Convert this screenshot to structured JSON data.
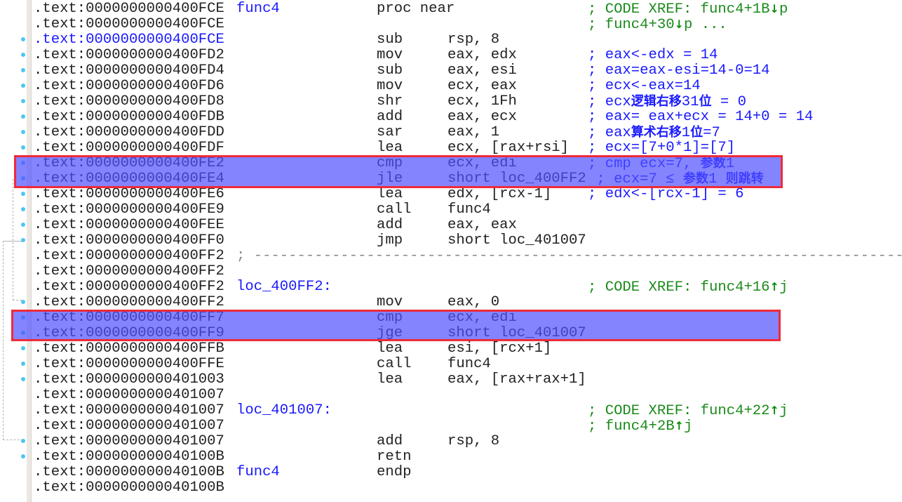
{
  "view": "IDA View",
  "colors": {
    "highlight": "#8080ff",
    "highlight_border": "#ee2b3a",
    "comment": "#1a1aff",
    "xref": "#1a8a1a",
    "label": "#1a1aff"
  },
  "lines": [
    {
      "addr": ".text:0000000000400FCE",
      "label": "func4",
      "mn": "proc near",
      "op": "",
      "cm": [
        {
          "t": "; CODE XREF: func4+1B"
        },
        {
          "t": "↓",
          "a": 1
        },
        {
          "t": "p"
        }
      ],
      "xref": true,
      "dot": false
    },
    {
      "addr": ".text:0000000000400FCE",
      "label": "",
      "mn": "",
      "op": "",
      "cm": [
        {
          "t": "; func4+30"
        },
        {
          "t": "↓",
          "a": 1
        },
        {
          "t": "p ..."
        }
      ],
      "xref": true,
      "dot": false
    },
    {
      "addr": ".text:0000000000400FCE",
      "cur": true,
      "label": "",
      "mn": "sub",
      "op": "rsp, 8",
      "cm": [],
      "dot": true
    },
    {
      "addr": ".text:0000000000400FD2",
      "label": "",
      "mn": "mov",
      "op": "eax, edx",
      "cm": [
        {
          "t": "; eax<-edx = 14"
        }
      ],
      "dot": true
    },
    {
      "addr": ".text:0000000000400FD4",
      "label": "",
      "mn": "sub",
      "op": "eax, esi",
      "cm": [
        {
          "t": "; eax=eax-esi=14-0=14"
        }
      ],
      "dot": true
    },
    {
      "addr": ".text:0000000000400FD6",
      "label": "",
      "mn": "mov",
      "op": "ecx, eax",
      "cm": [
        {
          "t": "; ecx<-eax=14"
        }
      ],
      "dot": true
    },
    {
      "addr": ".text:0000000000400FD8",
      "label": "",
      "mn": "shr",
      "op": "ecx, 1Fh",
      "cm": [
        {
          "t": "; ecx"
        },
        {
          "t": "逻辑右移",
          "b": 1
        },
        {
          "t": "31"
        },
        {
          "t": "位",
          "b": 1
        },
        {
          "t": " = 0"
        }
      ],
      "dot": true
    },
    {
      "addr": ".text:0000000000400FDB",
      "label": "",
      "mn": "add",
      "op": "eax, ecx",
      "cm": [
        {
          "t": "; eax= eax+ecx = 14+0 = 14"
        }
      ],
      "dot": true
    },
    {
      "addr": ".text:0000000000400FDD",
      "label": "",
      "mn": "sar",
      "op": "eax, 1",
      "cm": [
        {
          "t": "; eax"
        },
        {
          "t": "算术右移",
          "b": 1
        },
        {
          "t": "1"
        },
        {
          "t": "位",
          "b": 1
        },
        {
          "t": "=7"
        }
      ],
      "dot": true
    },
    {
      "addr": ".text:0000000000400FDF",
      "label": "",
      "mn": "lea",
      "op": "ecx, [rax+rsi]",
      "cm": [
        {
          "t": "; ecx=[7+0*1]=[7]"
        }
      ],
      "dot": true
    },
    {
      "addr": ".text:0000000000400FE2",
      "label": "",
      "mn": "cmp",
      "op": "ecx, edi",
      "cm": [
        {
          "t": "; cmp ecx=7, "
        },
        {
          "t": "参数",
          "b": 1
        },
        {
          "t": "1"
        }
      ],
      "dot": true
    },
    {
      "addr": ".text:0000000000400FE4",
      "label": "",
      "mn": "jle",
      "op": "short loc_400FF2",
      "cm": [
        {
          "t": " ; ecx=7 ≤ "
        },
        {
          "t": "参数",
          "b": 1
        },
        {
          "t": "1 "
        },
        {
          "t": "则跳转",
          "b": 1
        }
      ],
      "dot": true
    },
    {
      "addr": ".text:0000000000400FE6",
      "label": "",
      "mn": "lea",
      "op": "edx, [rcx-1]",
      "cm": [
        {
          "t": "; edx<-[rcx-1] = 6"
        }
      ],
      "dot": true
    },
    {
      "addr": ".text:0000000000400FE9",
      "label": "",
      "mn": "call",
      "op": "func4",
      "cm": [],
      "dot": true
    },
    {
      "addr": ".text:0000000000400FEE",
      "label": "",
      "mn": "add",
      "op": "eax, eax",
      "cm": [],
      "dot": true
    },
    {
      "addr": ".text:0000000000400FF0",
      "label": "",
      "mn": "jmp",
      "op": "short loc_401007",
      "cm": [],
      "dot": true
    },
    {
      "addr": ".text:0000000000400FF2",
      "label": "",
      "sep": "; ---------------------------------------------------------------------------",
      "mn": "",
      "op": "",
      "cm": [],
      "dot": false
    },
    {
      "addr": ".text:0000000000400FF2",
      "label": "",
      "mn": "",
      "op": "",
      "cm": [],
      "dot": false
    },
    {
      "addr": ".text:0000000000400FF2",
      "label": "loc_400FF2:",
      "mn": "",
      "op": "",
      "cm": [
        {
          "t": "; CODE XREF: func4+16"
        },
        {
          "t": "↑",
          "a": 1
        },
        {
          "t": "j"
        }
      ],
      "xref": true,
      "dot": false
    },
    {
      "addr": ".text:0000000000400FF2",
      "label": "",
      "mn": "mov",
      "op": "eax, 0",
      "cm": [],
      "dot": true
    },
    {
      "addr": ".text:0000000000400FF7",
      "label": "",
      "mn": "cmp",
      "op": "ecx, edi",
      "cm": [],
      "dot": true
    },
    {
      "addr": ".text:0000000000400FF9",
      "label": "",
      "mn": "jge",
      "op": "short loc_401007",
      "cm": [],
      "dot": true
    },
    {
      "addr": ".text:0000000000400FFB",
      "label": "",
      "mn": "lea",
      "op": "esi, [rcx+1]",
      "cm": [],
      "dot": true
    },
    {
      "addr": ".text:0000000000400FFE",
      "label": "",
      "mn": "call",
      "op": "func4",
      "cm": [],
      "dot": true
    },
    {
      "addr": ".text:0000000000401003",
      "label": "",
      "mn": "lea",
      "op": "eax, [rax+rax+1]",
      "cm": [],
      "dot": true
    },
    {
      "addr": ".text:0000000000401007",
      "label": "",
      "mn": "",
      "op": "",
      "cm": [],
      "dot": false
    },
    {
      "addr": ".text:0000000000401007",
      "label": "loc_401007:",
      "mn": "",
      "op": "",
      "cm": [
        {
          "t": "; CODE XREF: func4+22"
        },
        {
          "t": "↑",
          "a": 1
        },
        {
          "t": "j"
        }
      ],
      "xref": true,
      "dot": false
    },
    {
      "addr": ".text:0000000000401007",
      "label": "",
      "mn": "",
      "op": "",
      "cm": [
        {
          "t": "; func4+2B"
        },
        {
          "t": "↑",
          "a": 1
        },
        {
          "t": "j"
        }
      ],
      "xref": true,
      "dot": false
    },
    {
      "addr": ".text:0000000000401007",
      "label": "",
      "mn": "add",
      "op": "rsp, 8",
      "cm": [],
      "dot": true
    },
    {
      "addr": ".text:000000000040100B",
      "label": "",
      "mn": "retn",
      "op": "",
      "cm": [],
      "dot": true
    },
    {
      "addr": ".text:000000000040100B",
      "label": "func4",
      "mn": "endp",
      "op": "",
      "cm": [],
      "dot": false
    },
    {
      "addr": ".text:000000000040100B",
      "label": "",
      "mn": "",
      "op": "",
      "cm": [],
      "dot": false
    }
  ]
}
